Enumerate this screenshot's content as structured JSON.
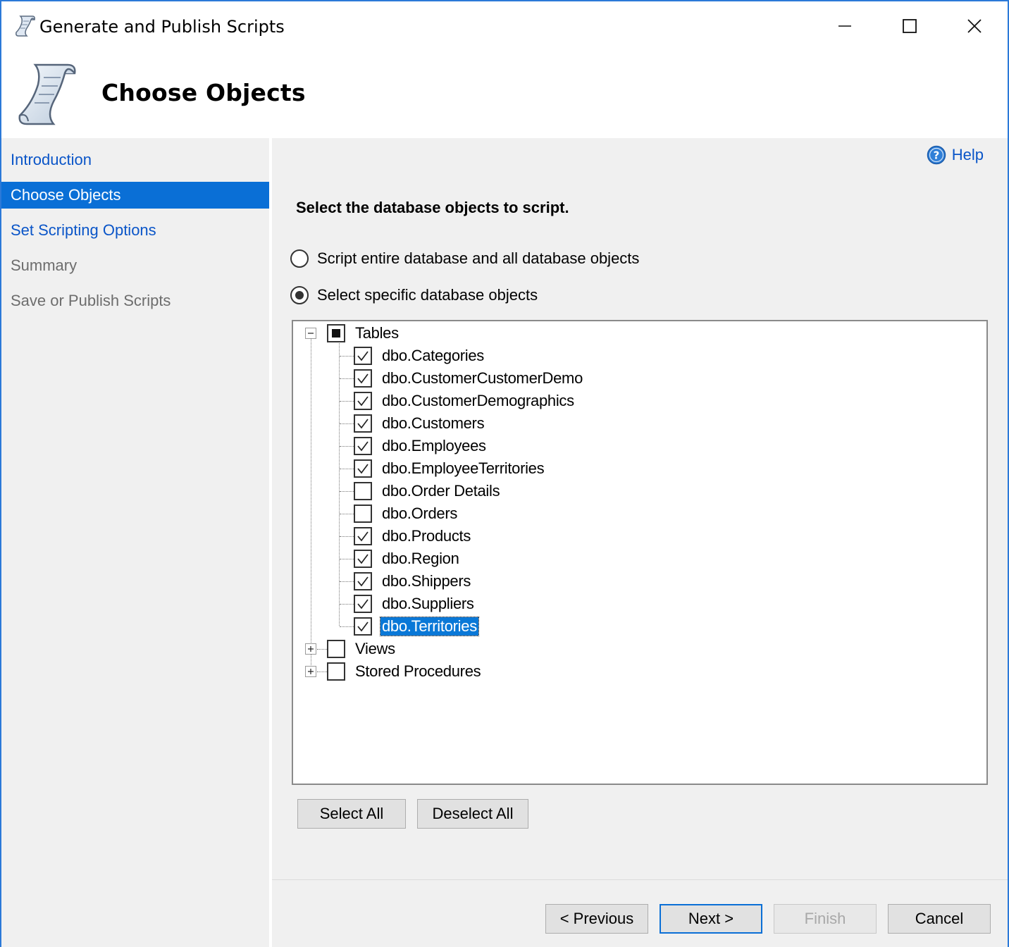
{
  "window": {
    "title": "Generate and Publish Scripts",
    "accent_color": "#2b79d8"
  },
  "header": {
    "title": "Choose Objects",
    "icon": "script-scroll-icon"
  },
  "sidebar": {
    "items": [
      {
        "label": "Introduction",
        "state": "link"
      },
      {
        "label": "Choose Objects",
        "state": "active"
      },
      {
        "label": "Set Scripting Options",
        "state": "link"
      },
      {
        "label": "Summary",
        "state": "disabled"
      },
      {
        "label": "Save or Publish Scripts",
        "state": "disabled"
      }
    ]
  },
  "main": {
    "help_label": "Help",
    "instruction": "Select the database objects to script.",
    "options": [
      {
        "label": "Script entire database and all database objects",
        "checked": false
      },
      {
        "label": "Select specific database objects",
        "checked": true
      }
    ],
    "tree": {
      "groups": [
        {
          "label": "Tables",
          "expanded": true,
          "state": "partial",
          "children": [
            {
              "label": "dbo.Categories",
              "checked": true
            },
            {
              "label": "dbo.CustomerCustomerDemo",
              "checked": true
            },
            {
              "label": "dbo.CustomerDemographics",
              "checked": true
            },
            {
              "label": "dbo.Customers",
              "checked": true
            },
            {
              "label": "dbo.Employees",
              "checked": true
            },
            {
              "label": "dbo.EmployeeTerritories",
              "checked": true
            },
            {
              "label": "dbo.Order Details",
              "checked": false
            },
            {
              "label": "dbo.Orders",
              "checked": false
            },
            {
              "label": "dbo.Products",
              "checked": true
            },
            {
              "label": "dbo.Region",
              "checked": true
            },
            {
              "label": "dbo.Shippers",
              "checked": true
            },
            {
              "label": "dbo.Suppliers",
              "checked": true
            },
            {
              "label": "dbo.Territories",
              "checked": true,
              "selected": true
            }
          ]
        },
        {
          "label": "Views",
          "expanded": false,
          "state": "unchecked"
        },
        {
          "label": "Stored Procedures",
          "expanded": false,
          "state": "unchecked"
        }
      ]
    },
    "select_all_label": "Select All",
    "deselect_all_label": "Deselect All"
  },
  "footer": {
    "previous_label": "< Previous",
    "next_label": "Next >",
    "finish_label": "Finish",
    "cancel_label": "Cancel"
  }
}
